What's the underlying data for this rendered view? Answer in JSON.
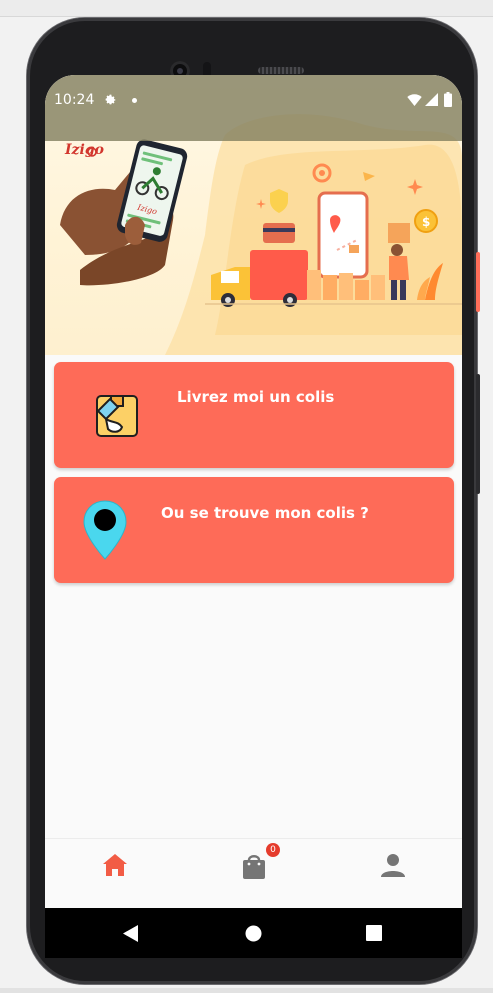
{
  "status_bar": {
    "time": "10:24",
    "icons": [
      "gear-icon",
      "dot-icon",
      "wifi-icon",
      "signal-icon",
      "battery-icon"
    ]
  },
  "banner": {
    "logo_text": "Izigo",
    "phone_screen_text": "Izigo"
  },
  "cards": [
    {
      "label": "Livrez moi un colis",
      "icon": "package-hand-icon"
    },
    {
      "label": "Ou se trouve mon colis ?",
      "icon": "map-pin-icon"
    }
  ],
  "bottom_nav": {
    "items": [
      "home-icon",
      "shopping-bag-icon",
      "user-icon"
    ],
    "active": "home",
    "cart_badge": "0"
  },
  "colors": {
    "accent": "#fe6b58",
    "pin": "#4ad7ee",
    "status_bar": "#848060",
    "frame": "#1d1d1f"
  }
}
